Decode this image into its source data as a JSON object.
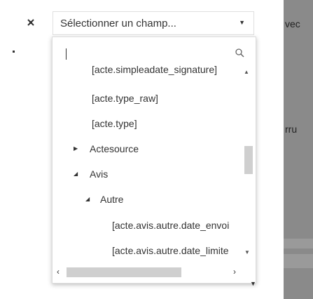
{
  "header": {
    "pin_icon": "pin-off-icon",
    "select_label": "Sélectionner un champ...",
    "caret_icon": "▼"
  },
  "search": {
    "value": "",
    "icon": "search-icon"
  },
  "tree": {
    "items": [
      {
        "label": "[acte.simpleadate_signature]",
        "type": "leaf"
      },
      {
        "label": "[acte.type_raw]",
        "type": "leaf"
      },
      {
        "label": "[acte.type]",
        "type": "leaf"
      },
      {
        "label": "Actesource",
        "type": "collapsed"
      },
      {
        "label": "Avis",
        "type": "expanded"
      },
      {
        "label": "Autre",
        "type": "expanded"
      },
      {
        "label": "[acte.avis.autre.date_envoi",
        "type": "leaf"
      },
      {
        "label": "[acte.avis.autre.date_limite",
        "type": "leaf"
      }
    ]
  },
  "scrollbars": {
    "vertical_position": 0.45,
    "horizontal_position": 0.0
  },
  "background": {
    "snippet_1": "vec",
    "snippet_2": "rru"
  }
}
